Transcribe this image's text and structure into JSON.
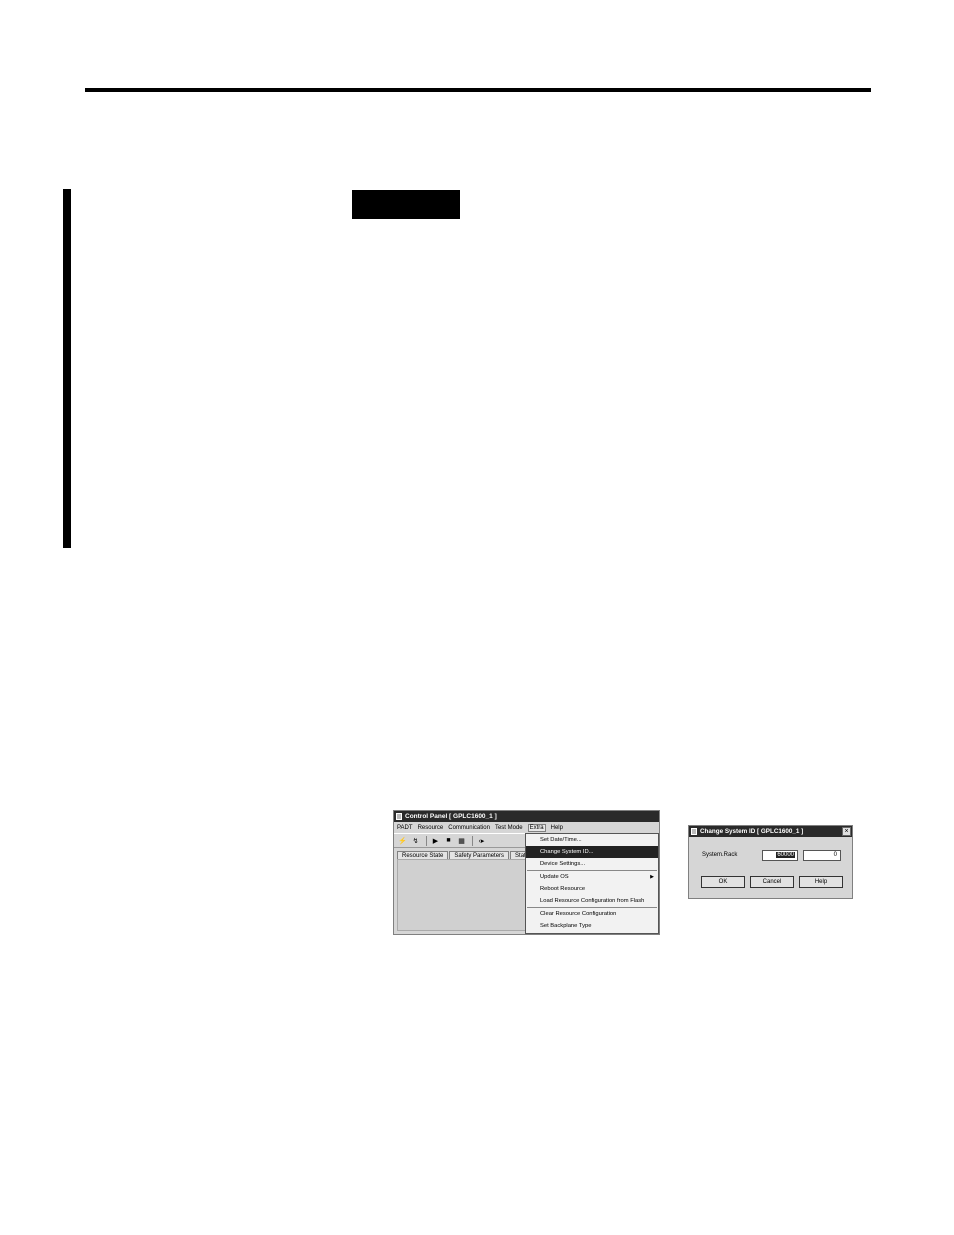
{
  "control_panel": {
    "title": "Control Panel [ GPLC1600_1 ]",
    "menu": [
      "PADT",
      "Resource",
      "Communication",
      "Test Mode",
      "Extra",
      "Help"
    ],
    "tabs": [
      "Resource State",
      "Safety Parameters",
      "Stat"
    ]
  },
  "extra_menu": {
    "items": [
      "Set Date/Time...",
      "Change System ID...",
      "Device Settings...",
      "Update OS",
      "Reboot Resource",
      "Load Resource Configuration from Flash",
      "Clear Resource Configuration",
      "Set Backplane Type"
    ]
  },
  "dialog": {
    "title": "Change System ID [ GPLC1600_1 ]",
    "label": "System.Rack",
    "system_value": "60000",
    "rack_value": "0",
    "ok": "OK",
    "cancel": "Cancel",
    "help": "Help"
  }
}
